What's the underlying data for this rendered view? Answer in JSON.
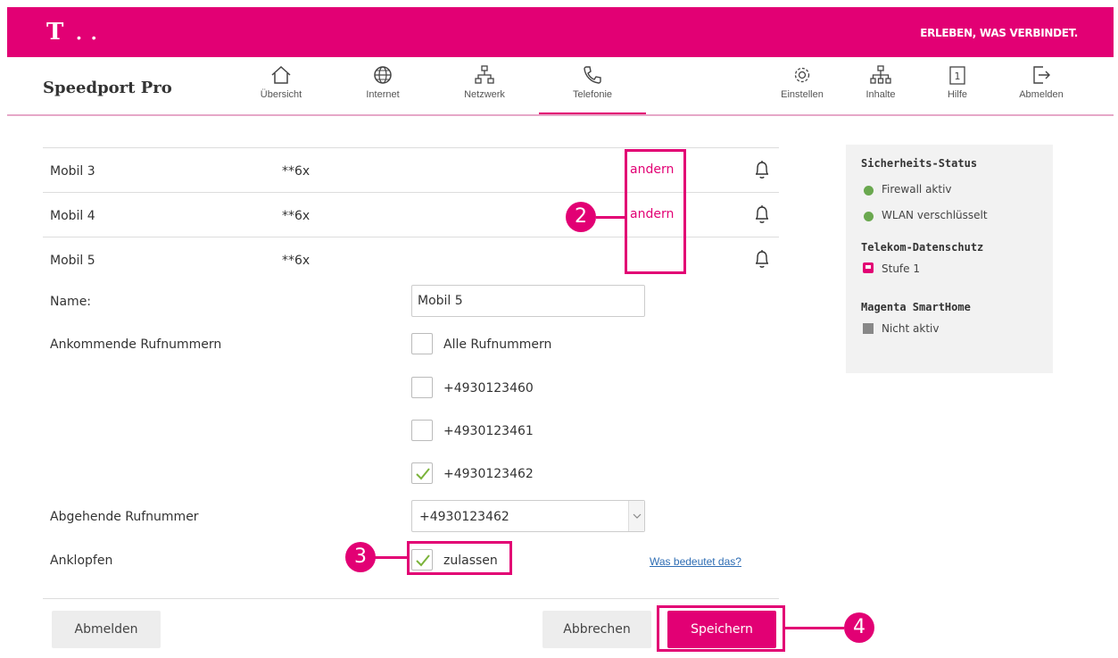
{
  "header": {
    "logo": "T",
    "logo_dots": "• •",
    "slogan": "ERLEBEN, WAS VERBINDET."
  },
  "nav": {
    "brand": "Speedport Pro",
    "items": [
      {
        "label": "Übersicht",
        "icon": "home-icon"
      },
      {
        "label": "Internet",
        "icon": "globe-icon"
      },
      {
        "label": "Netzwerk",
        "icon": "network-icon"
      },
      {
        "label": "Telefonie",
        "icon": "phone-icon"
      },
      {
        "label": "Einstellen",
        "icon": "gear-icon"
      },
      {
        "label": "Inhalte",
        "icon": "sitemap-icon"
      },
      {
        "label": "Hilfe",
        "icon": "help-icon"
      },
      {
        "label": "Abmelden",
        "icon": "logout-icon"
      }
    ]
  },
  "devices": [
    {
      "name": "Mobil 3",
      "number": "**6x",
      "link": "andern"
    },
    {
      "name": "Mobil 4",
      "number": "**6x",
      "link": "andern"
    },
    {
      "name": "Mobil 5",
      "number": "**6x",
      "link": ""
    }
  ],
  "form": {
    "name_label": "Name:",
    "name_value": "Mobil 5",
    "incoming_label": "Ankommende Rufnummern",
    "incoming_options": [
      {
        "label": "Alle Rufnummern",
        "checked": false
      },
      {
        "label": "+4930123460",
        "checked": false
      },
      {
        "label": "+4930123461",
        "checked": false
      },
      {
        "label": "+4930123462",
        "checked": true
      }
    ],
    "outgoing_label": "Abgehende Rufnummer",
    "outgoing_value": "+4930123462",
    "callwaiting_label": "Anklopfen",
    "callwaiting_option": "zulassen",
    "callwaiting_checked": true,
    "help_link": "Was bedeutet das?"
  },
  "buttons": {
    "logout": "Abmelden",
    "cancel": "Abbrechen",
    "save": "Speichern"
  },
  "sidebar": {
    "security_title": "Sicherheits-Status",
    "firewall": "Firewall aktiv",
    "wlan": "WLAN verschlüsselt",
    "privacy_title": "Telekom-Datenschutz",
    "privacy_level": "Stufe 1",
    "smarthome_title": "Magenta SmartHome",
    "smarthome_status": "Nicht aktiv"
  },
  "annotations": {
    "badge_2": "2",
    "badge_3": "3",
    "badge_4": "4"
  },
  "colors": {
    "magenta": "#e20074",
    "status_green": "#6aa84f",
    "link_blue": "#2e6db4"
  }
}
